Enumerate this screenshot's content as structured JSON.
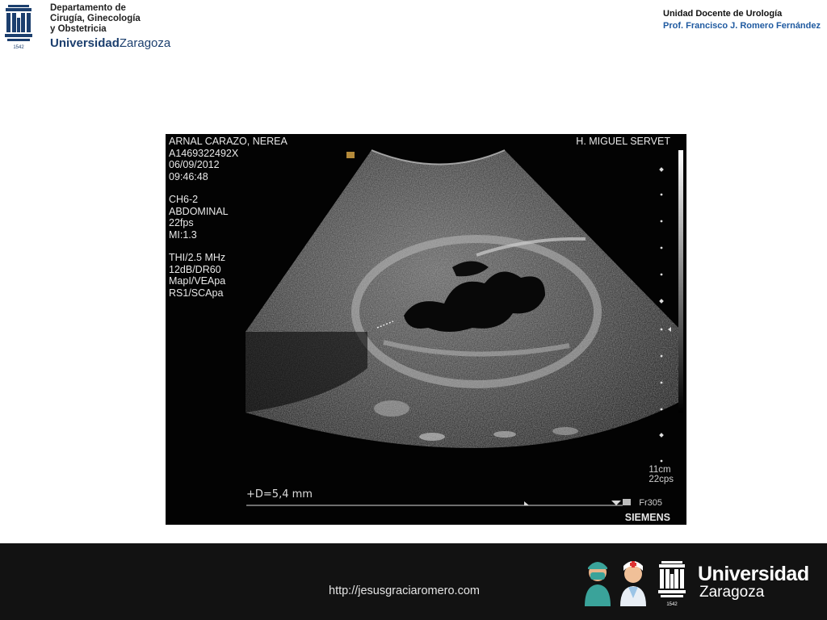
{
  "header": {
    "dept_lines": [
      "Departamento de",
      "Cirugía, Ginecología",
      "y Obstetricia"
    ],
    "uni_bold": "Universidad",
    "uni_city": "Zaragoza",
    "logo_year": "1542",
    "unit": "Unidad Docente de Urología",
    "professor": "Prof. Francisco J.  Romero Fernández"
  },
  "ultrasound": {
    "patient_name": "ARNAL CARAZO, NEREA",
    "patient_id": "A1469322492X",
    "date": "06/09/2012",
    "time": "09:46:48",
    "probe": "CH6-2",
    "preset": "ABDOMINAL",
    "fps": "22fps",
    "mi": "MI:1.3",
    "thi": "THI/2.5 MHz",
    "gain": "12dB/DR60",
    "map": "MapI/VEApa",
    "rs": "RS1/SCApa",
    "hospital": "H. MIGUEL SERVET",
    "depth": "11cm",
    "cps": "22cps",
    "measurement": "+D=5,4 mm",
    "frame": "Fr305",
    "brand": "SIEMENS"
  },
  "footer": {
    "url": "http://jesusgraciaromero.com",
    "uni_bold": "Universidad",
    "uni_city": "Zaragoza",
    "logo_year": "1542"
  }
}
